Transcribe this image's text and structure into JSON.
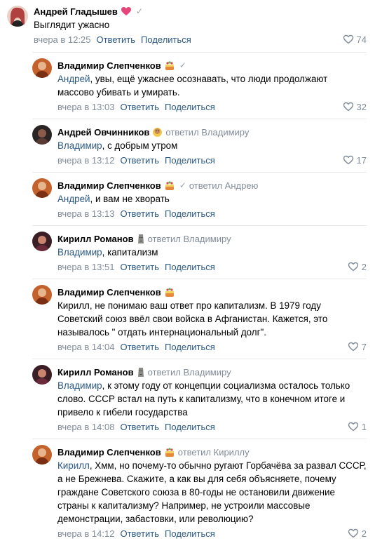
{
  "comments": [
    {
      "author": "Андрей Гладышев",
      "emoji": "heart",
      "verified": "✓",
      "replied_to": "",
      "mention": "",
      "text": "Выглядит ужасно",
      "date": "вчера в 12:25",
      "reply_label": "Ответить",
      "share_label": "Поделиться",
      "likes": "74",
      "avatar_color": "#b0413e"
    },
    {
      "author": "Владимир Слепченков",
      "emoji": "icon-cake",
      "verified": "✓",
      "replied_to": "",
      "mention": "Андрей",
      "text": ", увы, ещё ужаснее осознавать, что люди продолжают массово убивать и умирать.",
      "date": "вчера в 13:03",
      "reply_label": "Ответить",
      "share_label": "Поделиться",
      "likes": "32",
      "avatar_color": "#c4622d"
    },
    {
      "author": "Андрей Овчинников",
      "emoji": "icon-face",
      "verified": "",
      "replied_to": "ответил Владимиру",
      "mention": "Владимир",
      "text": ", с добрым утром",
      "date": "вчера в 13:12",
      "reply_label": "Ответить",
      "share_label": "Поделиться",
      "likes": "17",
      "avatar_color": "#5a3b34"
    },
    {
      "author": "Владимир Слепченков",
      "emoji": "icon-cake",
      "verified": "✓",
      "replied_to": "ответил Андрею",
      "mention": "Андрей",
      "text": ", и вам не хворать",
      "date": "вчера в 13:13",
      "reply_label": "Ответить",
      "share_label": "Поделиться",
      "likes": "",
      "avatar_color": "#c4622d"
    },
    {
      "author": "Кирилл Романов",
      "emoji": "icon-moai",
      "verified": "",
      "replied_to": "ответил Владимиру",
      "mention": "Владимир",
      "text": ", капитализм",
      "date": "вчера в 13:51",
      "reply_label": "Ответить",
      "share_label": "Поделиться",
      "likes": "2",
      "avatar_color": "#6b2a3a"
    },
    {
      "author": "Владимир Слепченков",
      "emoji": "icon-cake",
      "verified": "",
      "replied_to": "",
      "mention": "",
      "text": "Кирилл, не понимаю ваш ответ про капитализм. В 1979 году Советский союз ввёл свои войска в Афганистан. Кажется, это называлось \" отдать интернациональный долг\".",
      "date": "вчера в 14:04",
      "reply_label": "Ответить",
      "share_label": "Поделиться",
      "likes": "7",
      "avatar_color": "#c4622d"
    },
    {
      "author": "Кирилл Романов",
      "emoji": "icon-moai",
      "verified": "",
      "replied_to": "ответил Владимиру",
      "mention": "Владимир",
      "text": ", к этому году от концепции социализма осталось только слово. СССР встал на путь к капитализму, что в конечном итоге и привело к гибели государства",
      "date": "вчера в 14:08",
      "reply_label": "Ответить",
      "share_label": "Поделиться",
      "likes": "1",
      "avatar_color": "#6b2a3a"
    },
    {
      "author": "Владимир Слепченков",
      "emoji": "icon-cake",
      "verified": "",
      "replied_to": "ответил Кириллу",
      "mention": "Кирилл",
      "text": ", Хмм, но почему-то обычно ругают Горбачёва за развал СССР, а не Брежнева. Скажите, а как вы для себя объясняете, почему граждане Советского союза в 80-годы не остановили движение страны к капитализму? Например, не устроили массовые демонстрации, забастовки, или революцию?",
      "date": "вчера в 14:12",
      "reply_label": "Ответить",
      "share_label": "Поделиться",
      "likes": "2",
      "avatar_color": "#c4622d"
    }
  ],
  "colors": {
    "link": "#2a5885",
    "meta": "#818c99",
    "separator": "#e7e8ec"
  }
}
